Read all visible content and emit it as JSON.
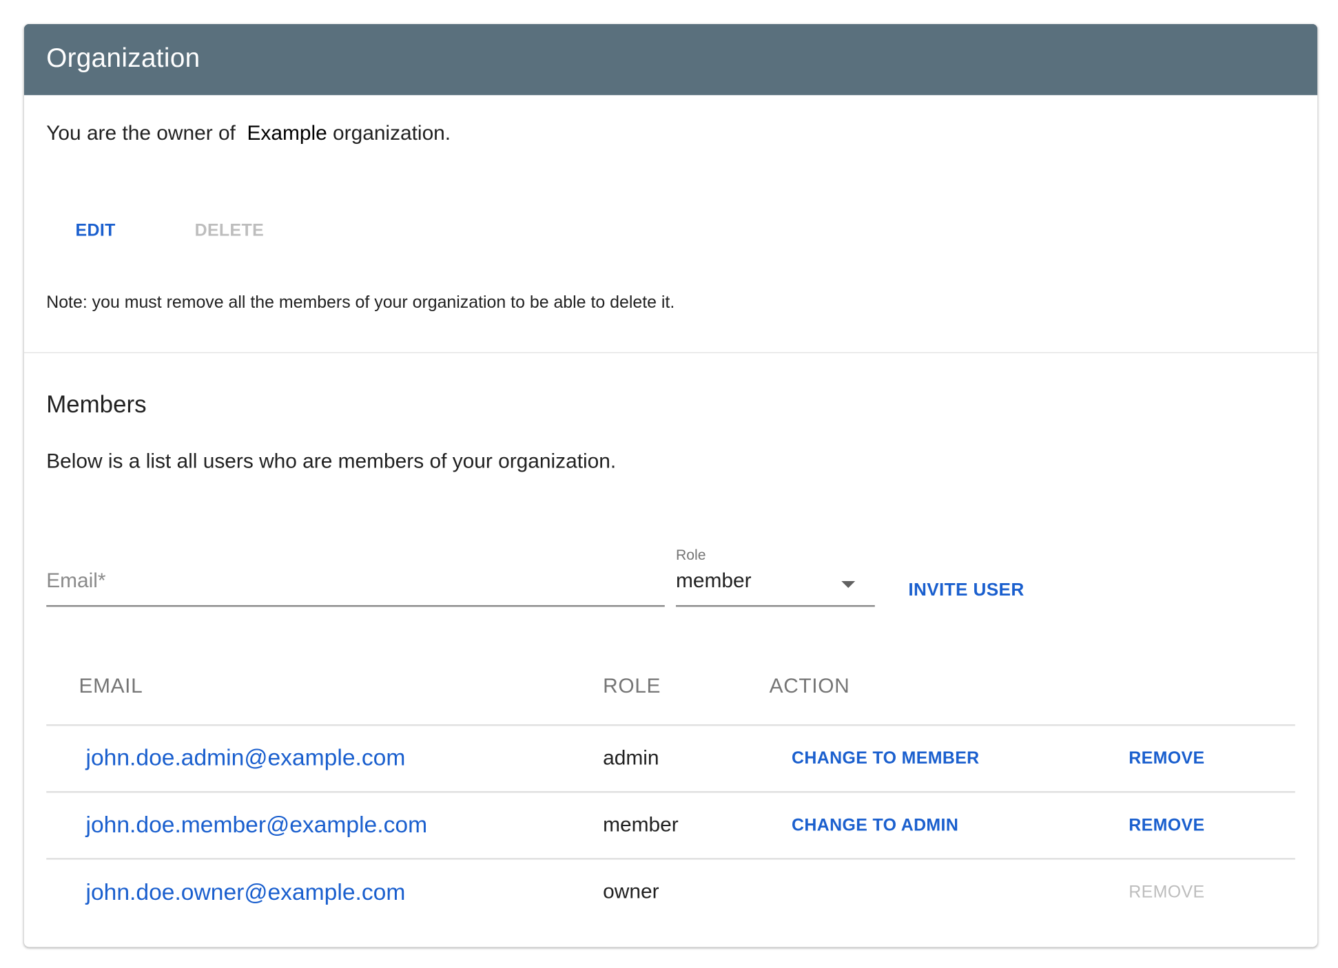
{
  "header": {
    "title": "Organization"
  },
  "owner": {
    "prefix": "You are the owner of",
    "org_name": "Example",
    "suffix": "organization."
  },
  "actions": {
    "edit": "EDIT",
    "delete": "DELETE"
  },
  "note": "Note: you must remove all the members of your organization to be able to delete it.",
  "members": {
    "title": "Members",
    "description": "Below is a list all users who are members of your organization.",
    "invite": {
      "email_placeholder": "Email*",
      "role_label": "Role",
      "role_value": "member",
      "invite_button": "INVITE USER"
    },
    "table": {
      "headers": [
        "EMAIL",
        "ROLE",
        "ACTION"
      ],
      "rows": [
        {
          "email": "john.doe.admin@example.com",
          "role": "admin",
          "change": "CHANGE TO MEMBER",
          "remove": "REMOVE",
          "remove_enabled": true
        },
        {
          "email": "john.doe.member@example.com",
          "role": "member",
          "change": "CHANGE TO ADMIN",
          "remove": "REMOVE",
          "remove_enabled": true
        },
        {
          "email": "john.doe.owner@example.com",
          "role": "owner",
          "change": "",
          "remove": "REMOVE",
          "remove_enabled": false
        }
      ]
    }
  },
  "colors": {
    "header": "#5a707d",
    "accent": "#1a5fce",
    "disabled": "#bdbdbd"
  }
}
